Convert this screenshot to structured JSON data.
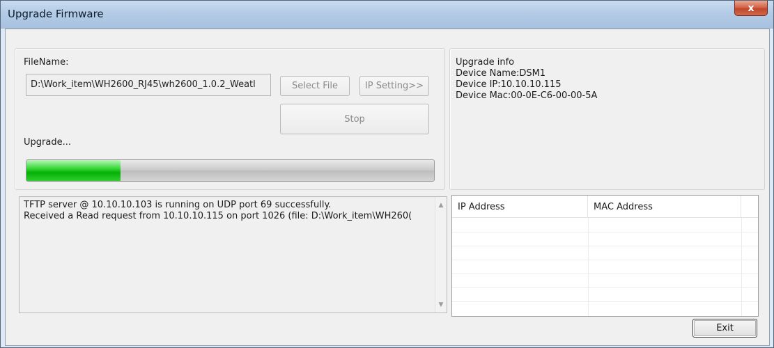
{
  "window": {
    "title": "Upgrade Firmware",
    "close_label": "x"
  },
  "file": {
    "label": "FileName:",
    "value": "D:\\Work_item\\WH2600_RJ45\\wh2600_1.0.2_Weatl"
  },
  "buttons": {
    "select_file": "Select File",
    "ip_setting": "IP Setting>>",
    "stop": "Stop",
    "exit": "Exit"
  },
  "upgrade": {
    "status": "Upgrade...",
    "progress_percent": 23
  },
  "info": {
    "heading": "Upgrade info",
    "device_name": "Device Name:DSM1",
    "device_ip": "Device IP:10.10.10.115",
    "device_mac": "Device Mac:00-0E-C6-00-00-5A"
  },
  "log": {
    "lines": [
      "TFTP server @ 10.10.10.103 is running on UDP port 69 successfully.",
      "Received a Read request from 10.10.10.115 on port 1026 (file: D:\\Work_item\\WH260("
    ]
  },
  "device_list": {
    "columns": [
      "IP Address",
      "MAC Address"
    ],
    "rows": []
  },
  "icons": {
    "close": "close-icon",
    "scroll_up": "chevron-up-icon",
    "scroll_down": "chevron-down-icon"
  }
}
